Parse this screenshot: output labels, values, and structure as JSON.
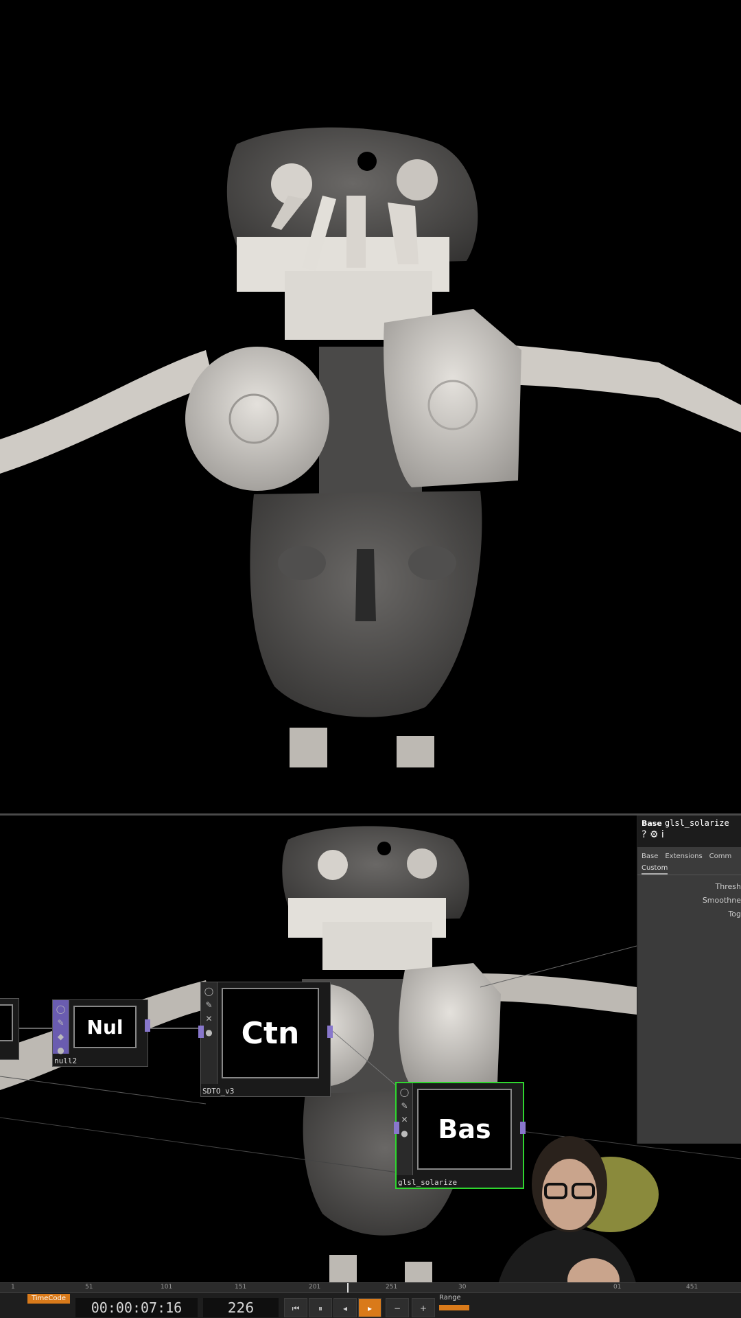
{
  "network": {
    "ops": {
      "nul": {
        "tag": "Nul",
        "caption": "null2"
      },
      "ctn": {
        "tag": "Ctn",
        "caption": "SDTO_v3"
      },
      "bas": {
        "tag": "Bas",
        "caption": "glsl_solarize"
      }
    }
  },
  "params": {
    "op_type": "Base",
    "op_name": "glsl_solarize",
    "tools": "? ⚙ i",
    "tabs": [
      "Base",
      "Extensions",
      "Comm"
    ],
    "active_subtab": "Custom",
    "labels": [
      "Thresh",
      "Smoothne",
      "Tog"
    ]
  },
  "timeline": {
    "ruler_ticks": [
      "1",
      "51",
      "101",
      "151",
      "201",
      "251",
      "30",
      "01",
      "451"
    ],
    "timecode_label": "TimeCode",
    "timecode": "00:00:07:16",
    "frame": "226",
    "range_label": "Range"
  },
  "colors": {
    "selected_op_border": "#2fd62f",
    "accent": "#d97a1a",
    "null_op_strip": "#6a5cb0"
  }
}
